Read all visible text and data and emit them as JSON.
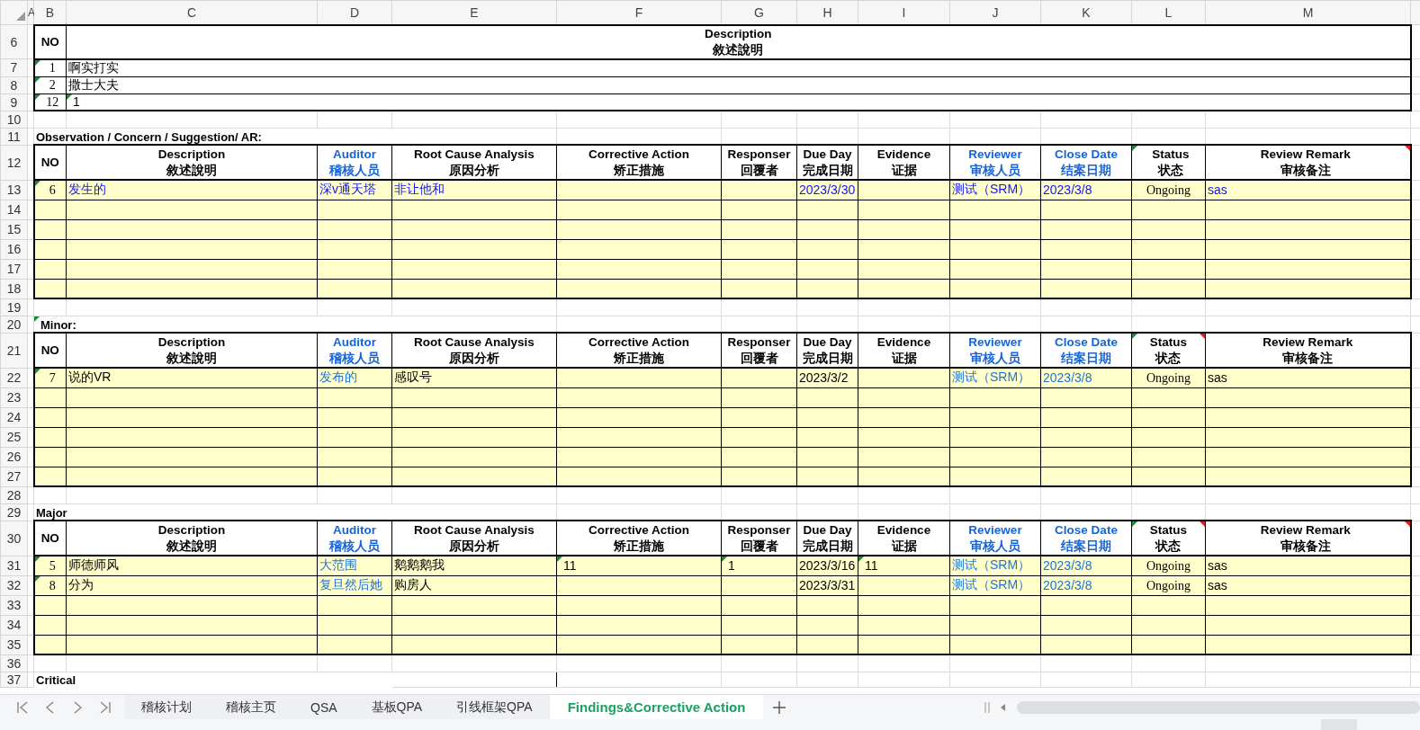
{
  "column_headers": [
    "A",
    "B",
    "C",
    "D",
    "E",
    "F",
    "G",
    "H",
    "I",
    "J",
    "K",
    "L",
    "M"
  ],
  "rows": [
    {
      "number": "6",
      "kind": "list-header",
      "cells": {
        "B": {
          "en": "NO"
        },
        "C": {
          "en": "Description",
          "zh": "敘述說明"
        }
      }
    },
    {
      "number": "7",
      "kind": "list-item",
      "cells": {
        "B": {
          "text": "1",
          "error_flag": true
        },
        "C": "啊实打实"
      }
    },
    {
      "number": "8",
      "kind": "list-item",
      "cells": {
        "B": {
          "text": "2",
          "error_flag": true
        },
        "C": "撒士大夫"
      }
    },
    {
      "number": "9",
      "kind": "list-item",
      "cells": {
        "B": {
          "text": "12",
          "error_flag": true
        },
        "C": {
          "text": "1",
          "error_flag": true
        }
      }
    },
    {
      "number": "10",
      "kind": "blank"
    },
    {
      "number": "11",
      "kind": "title",
      "cells": {
        "B": "Observation / Concern / Suggestion/ AR:"
      }
    },
    {
      "number": "12",
      "kind": "table-header",
      "cells": {
        "B": {
          "en": "NO"
        },
        "C": {
          "en": "Description",
          "zh": "敘述說明"
        },
        "D": {
          "en": "Auditor",
          "zh": "稽核人员",
          "color": "#1565d8"
        },
        "E": {
          "en": "Root Cause Analysis",
          "zh": "原因分析"
        },
        "F": {
          "en": "Corrective Action",
          "zh": "矫正措施"
        },
        "G": {
          "en": "Responser",
          "zh": "回覆者"
        },
        "H": {
          "en": "Due Day",
          "zh": "完成日期"
        },
        "I": {
          "en": "Evidence",
          "zh": "证据"
        },
        "J": {
          "en": "Reviewer",
          "zh": "审核人员",
          "color": "#1565d8"
        },
        "K": {
          "en": "Close Date",
          "zh": "结案日期",
          "color": "#1565d8"
        },
        "L": {
          "en": "Status",
          "zh": "状态",
          "error_flag": true
        },
        "M": {
          "en": "Review Remark",
          "zh": "审核备注",
          "comment_flag": true
        }
      }
    },
    {
      "number": "13",
      "kind": "table-row",
      "cells": {
        "B": {
          "text": "6",
          "error_flag": true
        },
        "C": {
          "text": "发生的",
          "color": "#1414f0"
        },
        "D": {
          "text": "深v通天塔",
          "color": "#1414f0"
        },
        "E": {
          "text": "非让他和",
          "color": "#1414f0"
        },
        "H": {
          "text": "2023/3/30",
          "color": "#1414f0"
        },
        "J": {
          "text": "测试（SRM）",
          "color": "#1414f0"
        },
        "K": {
          "text": "2023/3/8",
          "color": "#1414f0"
        },
        "L": "Ongoing",
        "M": {
          "text": "sas",
          "color": "#1414f0"
        }
      }
    },
    {
      "number": "14",
      "kind": "table-row"
    },
    {
      "number": "15",
      "kind": "table-row"
    },
    {
      "number": "16",
      "kind": "table-row"
    },
    {
      "number": "17",
      "kind": "table-row"
    },
    {
      "number": "18",
      "kind": "table-row"
    },
    {
      "number": "19",
      "kind": "blank"
    },
    {
      "number": "20",
      "kind": "title",
      "cells": {
        "B": {
          "text": "Minor:",
          "error_flag": true
        }
      }
    },
    {
      "number": "21",
      "kind": "table-header",
      "cells": {
        "B": {
          "en": "NO"
        },
        "C": {
          "en": "Description",
          "zh": "敘述說明"
        },
        "D": {
          "en": "Auditor",
          "zh": "稽核人员",
          "color": "#1565d8"
        },
        "E": {
          "en": "Root Cause Analysis",
          "zh": "原因分析"
        },
        "F": {
          "en": "Corrective Action",
          "zh": "矫正措施"
        },
        "G": {
          "en": "Responser",
          "zh": "回覆者"
        },
        "H": {
          "en": "Due Day",
          "zh": "完成日期"
        },
        "I": {
          "en": "Evidence",
          "zh": "证据"
        },
        "J": {
          "en": "Reviewer",
          "zh": "审核人员",
          "color": "#1565d8"
        },
        "K": {
          "en": "Close Date",
          "zh": "结案日期",
          "color": "#1565d8"
        },
        "L": {
          "en": "Status",
          "zh": "状态",
          "error_flag": true,
          "comment_flag": true
        },
        "M": {
          "en": "Review Remark",
          "zh": "审核备注"
        }
      }
    },
    {
      "number": "22",
      "kind": "table-row",
      "cells": {
        "B": {
          "text": "7",
          "error_flag": true
        },
        "C": "说的VR",
        "D": {
          "text": "发布的",
          "color": "#1e73d2"
        },
        "E": "感叹号",
        "H": "2023/3/2",
        "J": {
          "text": "测试（SRM）",
          "color": "#1e73d2"
        },
        "K": {
          "text": "2023/3/8",
          "color": "#1e73d2"
        },
        "L": "Ongoing",
        "M": "sas"
      }
    },
    {
      "number": "23",
      "kind": "table-row"
    },
    {
      "number": "24",
      "kind": "table-row"
    },
    {
      "number": "25",
      "kind": "table-row"
    },
    {
      "number": "26",
      "kind": "table-row"
    },
    {
      "number": "27",
      "kind": "table-row"
    },
    {
      "number": "28",
      "kind": "blank"
    },
    {
      "number": "29",
      "kind": "title",
      "cells": {
        "B": "Major"
      }
    },
    {
      "number": "30",
      "kind": "table-header",
      "cells": {
        "B": {
          "en": "NO"
        },
        "C": {
          "en": "Description",
          "zh": "敘述說明"
        },
        "D": {
          "en": "Auditor",
          "zh": "稽核人员",
          "color": "#1565d8"
        },
        "E": {
          "en": "Root Cause Analysis",
          "zh": "原因分析"
        },
        "F": {
          "en": "Corrective Action",
          "zh": "矫正措施"
        },
        "G": {
          "en": "Responser",
          "zh": "回覆者"
        },
        "H": {
          "en": "Due Day",
          "zh": "完成日期"
        },
        "I": {
          "en": "Evidence",
          "zh": "证据"
        },
        "J": {
          "en": "Reviewer",
          "zh": "审核人员",
          "color": "#1565d8"
        },
        "K": {
          "en": "Close Date",
          "zh": "结案日期",
          "color": "#1565d8"
        },
        "L": {
          "en": "Status",
          "zh": "状态",
          "error_flag": true,
          "comment_flag": true
        },
        "M": {
          "en": "Review Remark",
          "zh": "审核备注",
          "comment_flag": true
        }
      }
    },
    {
      "number": "31",
      "kind": "table-row",
      "cells": {
        "B": {
          "text": "5",
          "error_flag": true
        },
        "C": "师德师风",
        "D": {
          "text": "大范围",
          "color": "#1e73d2"
        },
        "E": "鹅鹅鹅我",
        "F": {
          "text": "11",
          "error_flag": true
        },
        "G": {
          "text": "1",
          "error_flag": true
        },
        "H": "2023/3/16",
        "I": {
          "text": "11",
          "error_flag": true
        },
        "J": {
          "text": "测试（SRM）",
          "color": "#1e73d2"
        },
        "K": {
          "text": "2023/3/8",
          "color": "#1e73d2"
        },
        "L": "Ongoing",
        "M": "sas"
      }
    },
    {
      "number": "32",
      "kind": "table-row",
      "cells": {
        "B": {
          "text": "8",
          "error_flag": true
        },
        "C": "分为",
        "D": {
          "text": "复旦然后她",
          "color": "#1e73d2"
        },
        "E": "购房人",
        "H": "2023/3/31",
        "J": {
          "text": "测试（SRM）",
          "color": "#1e73d2"
        },
        "K": {
          "text": "2023/3/8",
          "color": "#1e73d2"
        },
        "L": "Ongoing",
        "M": "sas"
      }
    },
    {
      "number": "33",
      "kind": "table-row"
    },
    {
      "number": "34",
      "kind": "table-row"
    },
    {
      "number": "35",
      "kind": "table-row"
    },
    {
      "number": "36",
      "kind": "blank"
    },
    {
      "number": "37",
      "kind": "title",
      "cells": {
        "B": "Critical",
        "E": {
          "outlined": true
        }
      }
    }
  ],
  "sheet_tabs": [
    {
      "label": "稽核计划",
      "selected": false
    },
    {
      "label": "稽核主页",
      "selected": false
    },
    {
      "label": "QSA",
      "selected": false
    },
    {
      "label": "基板QPA",
      "selected": false
    },
    {
      "label": "引线框架QPA",
      "selected": false
    },
    {
      "label": "Findings&Corrective Action",
      "selected": true
    }
  ]
}
